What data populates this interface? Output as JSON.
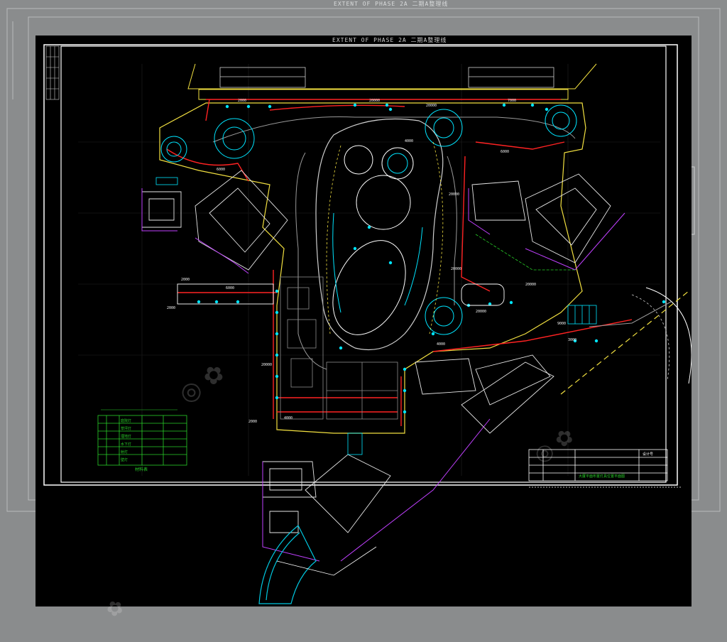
{
  "header": {
    "title": "EXTENT OF PHASE 2A   二期A整理线",
    "ghost_title": "EXTENT OF PHASE 2A   二期A整理线"
  },
  "dimensions": [
    "2000",
    "20000",
    "7000",
    "6000",
    "2000",
    "6000",
    "20000",
    "20000",
    "20000",
    "20000",
    "2000",
    "20000",
    "4000",
    "9000",
    "3000",
    "6000",
    "20000",
    "4000",
    "2000",
    "4000"
  ],
  "legend": {
    "caption": "材料表",
    "rows": [
      "庭院灯",
      "草坪灯",
      "埋地灯",
      "水下灯",
      "射灯",
      "壁灯"
    ]
  },
  "title_block": {
    "label": "设计号",
    "project": "大厦平面布置灯具位置平面图"
  },
  "colors": {
    "background": "#000000",
    "frame": "#ffffff",
    "accent_cyan": "#00e5ff",
    "accent_red": "#ff2222",
    "accent_yellow": "#f2e040",
    "accent_magenta": "#c040ff",
    "accent_green": "#28d028"
  }
}
